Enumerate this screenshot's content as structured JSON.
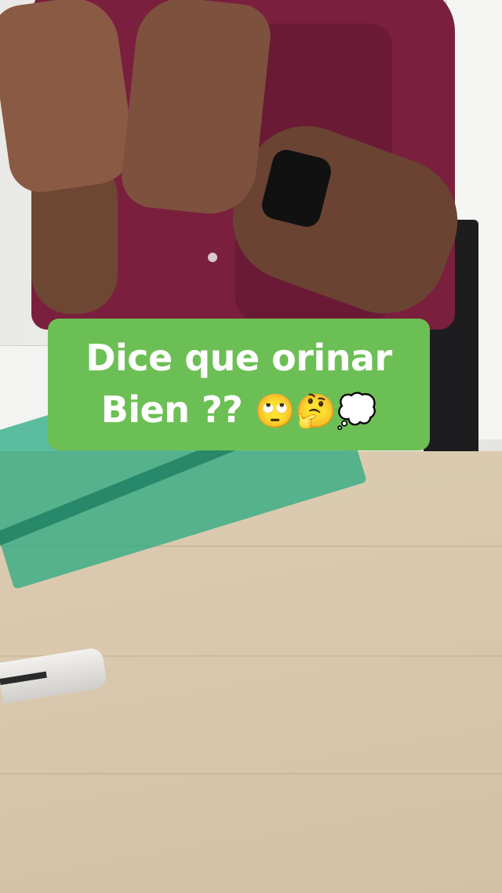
{
  "caption": {
    "line1": "Dice que orinar",
    "line2_text": "Bien ??",
    "line2_emojis": "🙄🤔💭",
    "background_color": "#6cbf55",
    "text_color": "#ffffff"
  }
}
